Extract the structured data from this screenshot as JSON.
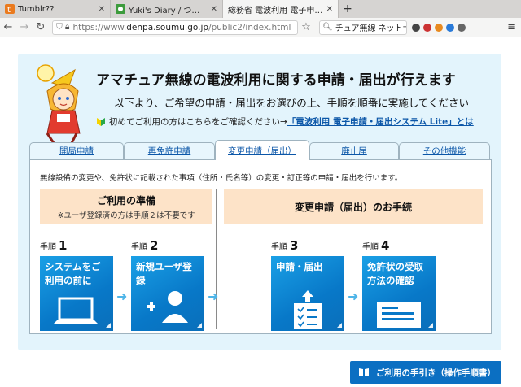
{
  "browser": {
    "tabs": [
      {
        "label": "Tumblr??",
        "active": false
      },
      {
        "label": "Yuki's Diary / つれづれE",
        "active": false
      },
      {
        "label": "総務省 電波利用 電子申請・",
        "active": true
      }
    ],
    "url_prefix": "https://www.",
    "url_domain": "denpa.soumu.go.jp",
    "url_path": "/public2/index.html",
    "search_text": "チュア無線 ネット"
  },
  "page": {
    "headline": "アマチュア無線の電波利用に関する申請・届出が行えます",
    "subhead": "以下より、ご希望の申請・届出をお選びの上、手順を順番に実施してください",
    "first_time_note": "初めてご利用の方はこちらをご確認ください→",
    "first_time_link": "「電波利用 電子申請・届出システム Lite」とは",
    "tabs": [
      {
        "label": "開局申請"
      },
      {
        "label": "再免許申請"
      },
      {
        "label": "変更申請（届出）"
      },
      {
        "label": "廃止届"
      },
      {
        "label": "その他機能"
      }
    ],
    "intro": "無線設備の変更や、免許状に記載された事項（住所・氏名等）の変更・訂正等の申請・届出を行います。",
    "prep_title": "ご利用の準備",
    "prep_note": "※ユーザ登録済の方は手順２は不要です",
    "change_title": "変更申請（届出）のお手続",
    "step_word": "手順",
    "steps": [
      {
        "num": "1",
        "label": "システムをご利用の前に"
      },
      {
        "num": "2",
        "label": "新規ユーザ登録"
      },
      {
        "num": "3",
        "label": "申請・届出"
      },
      {
        "num": "4",
        "label": "免許状の受取方法の確認"
      }
    ],
    "manual_button": "ご利用の手引き（操作手順書）"
  },
  "colors": {
    "accent": "#0b6fc2",
    "frame_bg": "#e3f4fc",
    "header_bg": "#fde3c8",
    "link": "#0b56a8"
  }
}
